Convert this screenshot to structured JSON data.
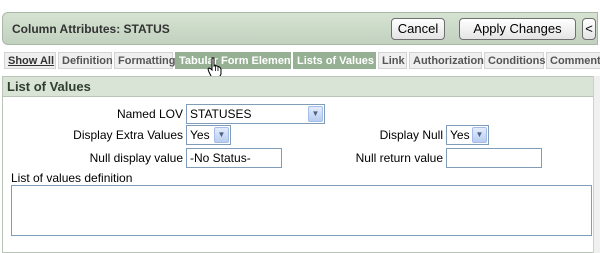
{
  "header": {
    "title": "Column Attributes: STATUS",
    "cancel_label": "Cancel",
    "apply_label": "Apply Changes",
    "prev_label": "<"
  },
  "tabs": [
    {
      "label": "Show All"
    },
    {
      "label": "Definition"
    },
    {
      "label": "Formatting"
    },
    {
      "label": "Tabular Form Element"
    },
    {
      "label": "Lists of Values"
    },
    {
      "label": "Link"
    },
    {
      "label": "Authorization"
    },
    {
      "label": "Conditions"
    },
    {
      "label": "Comments"
    }
  ],
  "region": {
    "title": "List of Values",
    "named_lov": {
      "label": "Named LOV",
      "value": "STATUSES"
    },
    "display_extra": {
      "label": "Display Extra Values",
      "value": "Yes"
    },
    "display_null": {
      "label": "Display Null",
      "value": "Yes"
    },
    "null_display": {
      "label": "Null display value",
      "value": "-No Status-"
    },
    "null_return": {
      "label": "Null return value",
      "value": ""
    },
    "lov_definition": {
      "label": "List of values definition",
      "value": ""
    }
  },
  "icons": {
    "dropdown": "chevron-down-icon",
    "pointer": "hand-pointer-icon"
  },
  "colors": {
    "header_bg": "#c8d6c4",
    "active_tab": "#96b093",
    "region_title_bg": "#d9e3d6"
  }
}
